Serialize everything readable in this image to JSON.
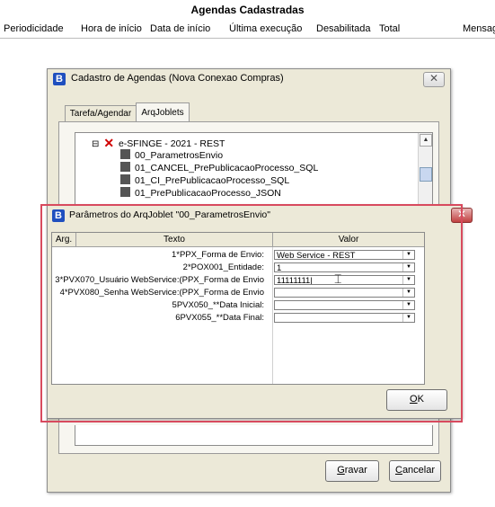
{
  "background": {
    "title": "Agendas Cadastradas",
    "columns": [
      "Periodicidade",
      "Hora de início",
      "Data de início",
      "Última execução",
      "Desabilitada",
      "Total",
      "Mensag"
    ]
  },
  "outer_window": {
    "icon_letter": "B",
    "title": "Cadastro de Agendas (Nova Conexao Compras)",
    "close_glyph": "✕",
    "tabs": [
      {
        "label": "Tarefa/Agendar",
        "active": false
      },
      {
        "label": "ArqJoblets",
        "active": true
      }
    ],
    "tree": {
      "expander": "⊟",
      "root_label": "e-SFINGE - 2021 - REST",
      "items": [
        "00_ParametrosEnvio",
        "01_CANCEL_PrePublicacaoProcesso_SQL",
        "01_CI_PrePublicacaoProcesso_SQL",
        "01_PrePublicacaoProcesso_JSON"
      ]
    },
    "buttons": {
      "gravar": {
        "prefix": "",
        "accel": "G",
        "rest": "ravar"
      },
      "cancelar": {
        "prefix": "",
        "accel": "C",
        "rest": "ancelar"
      }
    }
  },
  "dialog": {
    "icon_letter": "B",
    "title": "Parâmetros do ArqJoblet \"00_ParametrosEnvio\"",
    "close_glyph": "✕",
    "columns": {
      "arg": "Arg.",
      "texto": "Texto",
      "valor": "Valor"
    },
    "rows": [
      {
        "label": "1*PPX_Forma de Envio:",
        "value": "Web Service - REST"
      },
      {
        "label": "2*POX001_Entidade:",
        "value": "1"
      },
      {
        "label": "3*PVX070_Usuário WebService:(PPX_Forma de Envio",
        "value": "11111111|"
      },
      {
        "label": "4*PVX080_Senha WebService:(PPX_Forma de Envio",
        "value": ""
      },
      {
        "label": "5PVX050_**Data Inicial:",
        "value": ""
      },
      {
        "label": "6PVX055_**Data Final:",
        "value": ""
      }
    ],
    "ok_button": {
      "accel": "O",
      "rest": "K"
    },
    "dropdown_glyph": "▼",
    "highlight_color": "#d84a5e"
  }
}
